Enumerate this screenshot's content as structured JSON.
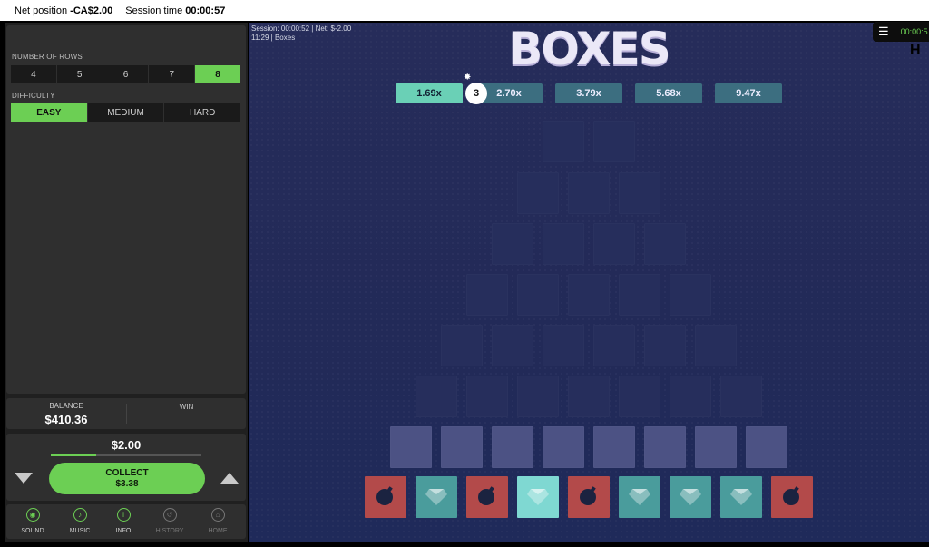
{
  "topbar": {
    "net_label": "Net position",
    "net_value": "-CA$2.00",
    "session_label": "Session time",
    "session_value": "00:00:57"
  },
  "rows": {
    "label": "NUMBER OF ROWS",
    "options": [
      "4",
      "5",
      "6",
      "7",
      "8"
    ],
    "selected": "8"
  },
  "difficulty": {
    "label": "DIFFICULTY",
    "options": [
      "EASY",
      "MEDIUM",
      "HARD"
    ],
    "selected": "EASY"
  },
  "balance": {
    "balance_label": "BALANCE",
    "balance_value": "$410.36",
    "win_label": "WIN",
    "win_value": ""
  },
  "bet": {
    "value": "$2.00",
    "progress": 0.3,
    "collect_label": "COLLECT",
    "collect_value": "$3.38"
  },
  "footer": {
    "sound": "SOUND",
    "music": "MUSIC",
    "info": "INFO",
    "history": "HISTORY",
    "home": "HOME"
  },
  "game": {
    "title": "BOXES",
    "session_line": "Session: 00:00:52",
    "net_line": "Net:   $-2.00",
    "time_line": "11:29",
    "game_line": "Boxes",
    "bomb_count": "3",
    "multipliers": [
      "1.69x",
      "2.70x",
      "3.79x",
      "5.68x",
      "9.47x"
    ],
    "active_multiplier_index": 0,
    "bottom_row": [
      "bomb",
      "gem",
      "bomb",
      "gem-selected",
      "bomb",
      "gem",
      "gem",
      "gem",
      "bomb"
    ]
  },
  "menu": {
    "time": "00:00:5"
  },
  "colors": {
    "accent_green": "#6ccf54",
    "game_bg": "#232b59",
    "multiplier": "#3c6e80",
    "multiplier_active": "#6ad0b6",
    "bomb_tile": "#b34a4a",
    "gem_tile": "#4a9c9c"
  }
}
